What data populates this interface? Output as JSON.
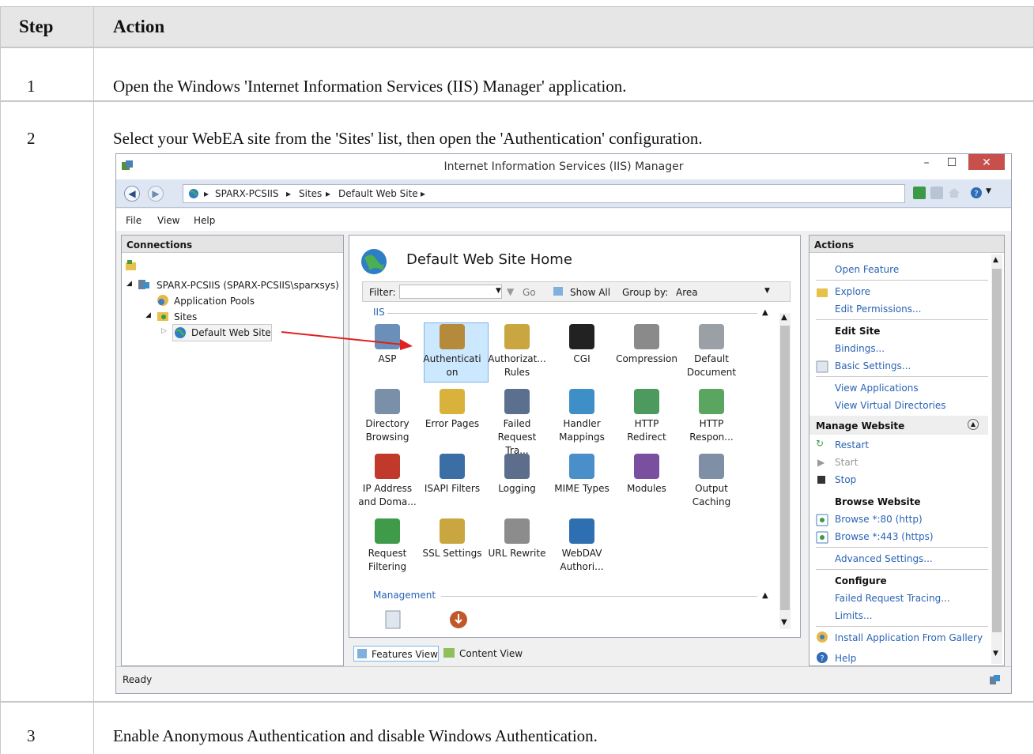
{
  "table": {
    "headers": {
      "step": "Step",
      "action": "Action"
    },
    "rows": [
      {
        "step": "1",
        "action": "Open the Windows 'Internet Information Services (IIS) Manager' application."
      },
      {
        "step": "2",
        "action": "Select your WebEA site from the 'Sites' list, then open the 'Authentication' configuration."
      },
      {
        "step": "3",
        "action": "Enable Anonymous Authentication and disable Windows Authentication."
      }
    ]
  },
  "iis": {
    "window_title": "Internet Information Services (IIS) Manager",
    "window_controls": {
      "minimize": "–",
      "maximize": "☐",
      "close": "✕"
    },
    "breadcrumbs": [
      "SPARX-PCSIIS",
      "Sites",
      "Default Web Site"
    ],
    "crumb_sep": "▸",
    "menu": [
      "File",
      "View",
      "Help"
    ],
    "connections": {
      "title": "Connections",
      "server": "SPARX-PCSIIS (SPARX-PCSIIS\\sparxsys)",
      "app_pools": "Application Pools",
      "sites": "Sites",
      "site": "Default Web Site"
    },
    "center": {
      "title": "Default Web Site Home",
      "filter_label": "Filter:",
      "go_label": "Go",
      "show_all": "Show All",
      "group_by_label": "Group by:",
      "group_by_value": "Area",
      "section_iis": "IIS",
      "section_management": "Management",
      "features": [
        {
          "label": "ASP",
          "icon": "asp-icon",
          "color": "#6a8fb8"
        },
        {
          "label": "Authenticati on",
          "icon": "authentication-icon",
          "color": "#b58a3a"
        },
        {
          "label": "Authorizat... Rules",
          "icon": "authorization-rules-icon",
          "color": "#c9a640"
        },
        {
          "label": "CGI",
          "icon": "cgi-icon",
          "color": "#222222"
        },
        {
          "label": "Compression",
          "icon": "compression-icon",
          "color": "#8a8a8a"
        },
        {
          "label": "Default Document",
          "icon": "default-document-icon",
          "color": "#9aa0a6"
        },
        {
          "label": "Directory Browsing",
          "icon": "directory-browsing-icon",
          "color": "#7a8fa8"
        },
        {
          "label": "Error Pages",
          "icon": "error-pages-icon",
          "color": "#d8b23a"
        },
        {
          "label": "Failed Request Tra...",
          "icon": "failed-request-tracing-icon",
          "color": "#5b6f8f"
        },
        {
          "label": "Handler Mappings",
          "icon": "handler-mappings-icon",
          "color": "#3e8ec8"
        },
        {
          "label": "HTTP Redirect",
          "icon": "http-redirect-icon",
          "color": "#4c9a5e"
        },
        {
          "label": "HTTP Respon...",
          "icon": "http-response-headers-icon",
          "color": "#5aa660"
        },
        {
          "label": "IP Address and Doma...",
          "icon": "ip-address-icon",
          "color": "#c0392b"
        },
        {
          "label": "ISAPI Filters",
          "icon": "isapi-filters-icon",
          "color": "#3a6ea5"
        },
        {
          "label": "Logging",
          "icon": "logging-icon",
          "color": "#5d6d8c"
        },
        {
          "label": "MIME Types",
          "icon": "mime-types-icon",
          "color": "#4a8fc9"
        },
        {
          "label": "Modules",
          "icon": "modules-icon",
          "color": "#7b4fa0"
        },
        {
          "label": "Output Caching",
          "icon": "output-caching-icon",
          "color": "#7f8fa6"
        },
        {
          "label": "Request Filtering",
          "icon": "request-filtering-icon",
          "color": "#3f9a4a"
        },
        {
          "label": "SSL Settings",
          "icon": "ssl-settings-icon",
          "color": "#c9a640"
        },
        {
          "label": "URL Rewrite",
          "icon": "url-rewrite-icon",
          "color": "#8c8c8c"
        },
        {
          "label": "WebDAV Authori...",
          "icon": "webdav-icon",
          "color": "#2d6fb0"
        }
      ],
      "view_tabs": [
        "Features View",
        "Content View"
      ]
    },
    "actions": {
      "title": "Actions",
      "open_feature": "Open Feature",
      "explore": "Explore",
      "edit_permissions": "Edit Permissions...",
      "edit_site": "Edit Site",
      "bindings": "Bindings...",
      "basic_settings": "Basic Settings...",
      "view_applications": "View Applications",
      "view_virtual_directories": "View Virtual Directories",
      "manage_website": "Manage Website",
      "restart": "Restart",
      "start": "Start",
      "stop": "Stop",
      "browse_website": "Browse Website",
      "browse_80": "Browse *:80 (http)",
      "browse_443": "Browse *:443 (https)",
      "advanced_settings": "Advanced Settings...",
      "configure": "Configure",
      "failed_request_tracing": "Failed Request Tracing...",
      "limits": "Limits...",
      "install_app": "Install Application From Gallery",
      "help": "Help"
    },
    "status": "Ready",
    "colors": {
      "link": "#2863b5",
      "selection": "#cce8ff",
      "arrow": "#e02020",
      "close_button": "#c7504d"
    }
  }
}
